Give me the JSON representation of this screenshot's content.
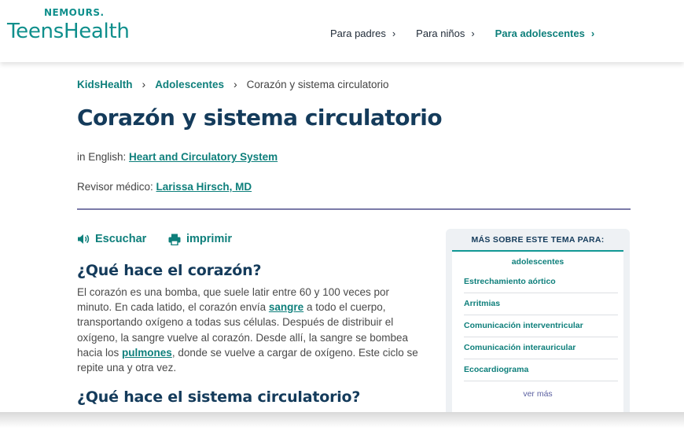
{
  "brand": {
    "top": "NEMOURS.",
    "name": "TeensHealth"
  },
  "nav": {
    "items": [
      {
        "label": "Para padres"
      },
      {
        "label": "Para niños"
      },
      {
        "label": "Para adolescentes"
      }
    ]
  },
  "breadcrumb": {
    "items": [
      "KidsHealth",
      "Adolescentes"
    ],
    "current": "Corazón y sistema circulatorio"
  },
  "page": {
    "title": "Corazón y sistema circulatorio",
    "english_prefix": "in English: ",
    "english_link": "Heart and Circulatory System",
    "reviewer_prefix": "Revisor médico: ",
    "reviewer_link": "Larissa Hirsch, MD"
  },
  "tools": {
    "listen": "Escuchar",
    "print": "imprimir"
  },
  "section1": {
    "heading": "¿Qué hace el corazón?",
    "text_a": "El corazón es una bomba, que suele latir entre 60 y 100 veces por minuto. En cada latido, el corazón envía ",
    "link_a": "sangre",
    "text_b": " a todo el cuerpo, transportando oxígeno a todas sus células. Después de distribuir el oxígeno, la sangre vuelve al corazón. Desde allí, la sangre se bombea hacia los ",
    "link_b": "pulmones",
    "text_c": ", donde se vuelve a cargar de oxígeno. Este ciclo se repite una y otra vez."
  },
  "section2": {
    "heading": "¿Qué hace el sistema circulatorio?"
  },
  "sidebar": {
    "header": "MÁS SOBRE ESTE TEMA PARA:",
    "audience": "adolescentes",
    "items": [
      "Estrechamiento aórtico",
      "Arritmias",
      "Comunicación interventricular",
      "Comunicación interauricular",
      "Ecocardiograma"
    ],
    "more": "ver más"
  },
  "colors": {
    "accent": "#0e7f7b",
    "title": "#143b5b",
    "divider": "#7b7aa8"
  }
}
